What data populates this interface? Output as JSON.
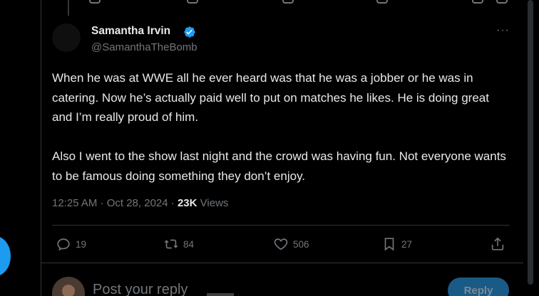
{
  "tweet": {
    "author_name": "Samantha Irvin",
    "author_handle": "@SamanthaTheBomb",
    "more_label": "···",
    "paragraphs": [
      "When he was at WWE all he ever heard was that he was a jobber or he was in catering. Now he’s actually paid well to put on matches he likes. He is doing great and I’m really proud of him.",
      "Also I went to the show last night and the crowd was having fun. Not everyone wants to be famous doing something they don’t enjoy."
    ],
    "timestamp": "12:25 AM · Oct 28, 2024",
    "separator": "·",
    "views_count": "23K",
    "views_label": "Views"
  },
  "actions": {
    "replies": "19",
    "reposts": "84",
    "likes": "506",
    "bookmarks": "27"
  },
  "reply_box": {
    "placeholder": "Post your reply",
    "button_label": "Reply"
  },
  "colors": {
    "background": "#000000",
    "text": "#e7e9ea",
    "muted": "#71767b",
    "accent": "#1d9bf0",
    "border": "#2f3336"
  }
}
